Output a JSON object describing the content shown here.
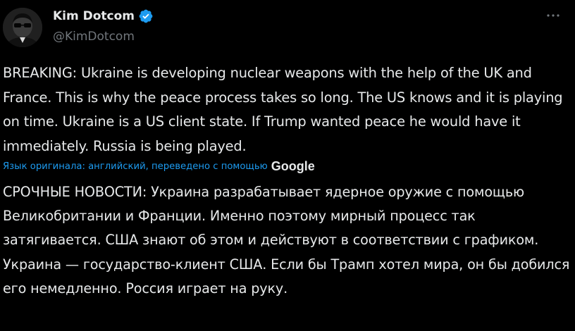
{
  "author": {
    "name": "Kim Dotcom",
    "handle": "@KimDotcom",
    "verified": true,
    "avatar_icon": "avatar-photo"
  },
  "tweet": {
    "text_original": "BREAKING: Ukraine is developing nuclear weapons with the help of the UK and France. This is why the peace process takes so long. The US knows and it is playing on time. Ukraine is a US client state. If Trump wanted peace he would have it immediately. Russia is being played.",
    "translation_note": "Язык оригинала: английский, переведено с помощью",
    "translation_provider": "Google",
    "text_translated": "СРОЧНЫЕ НОВОСТИ: Украина разрабатывает ядерное оружие с помощью Великобритании и Франции. Именно поэтому мирный процесс так затягивается. США знают об этом и действуют в соответствии с графиком. Украина — государство-клиент США. Если бы Трамп хотел мира, он бы добился его немедленно. Россия играет на руку."
  },
  "icons": {
    "verified": "verified-badge-icon",
    "more": "more-options-icon"
  },
  "colors": {
    "background": "#000000",
    "text": "#e7e9ea",
    "secondary": "#71767b",
    "link": "#1d9bf0",
    "verified": "#1d9bf0"
  }
}
